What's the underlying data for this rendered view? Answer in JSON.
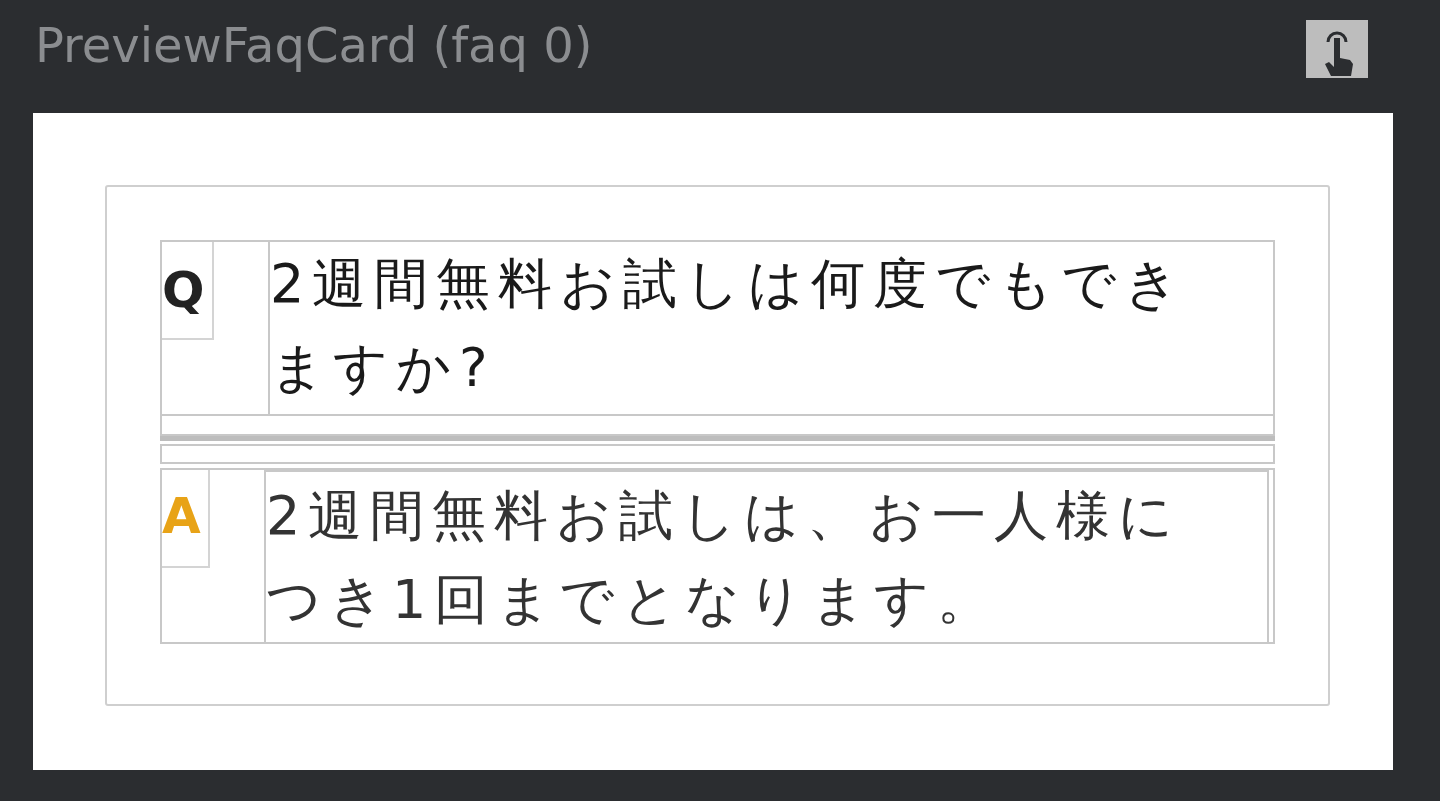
{
  "preview": {
    "title": "PreviewFaqCard (faq 0)"
  },
  "faq": [
    {
      "kind": "question",
      "label": "Q",
      "color": "#222222",
      "text": "2週間無料お試しは何度でもできますか?"
    },
    {
      "kind": "answer",
      "label": "A",
      "color": "#e8a317",
      "text": "2週間無料お試しは、お一人様につき1回までとなります。"
    }
  ]
}
